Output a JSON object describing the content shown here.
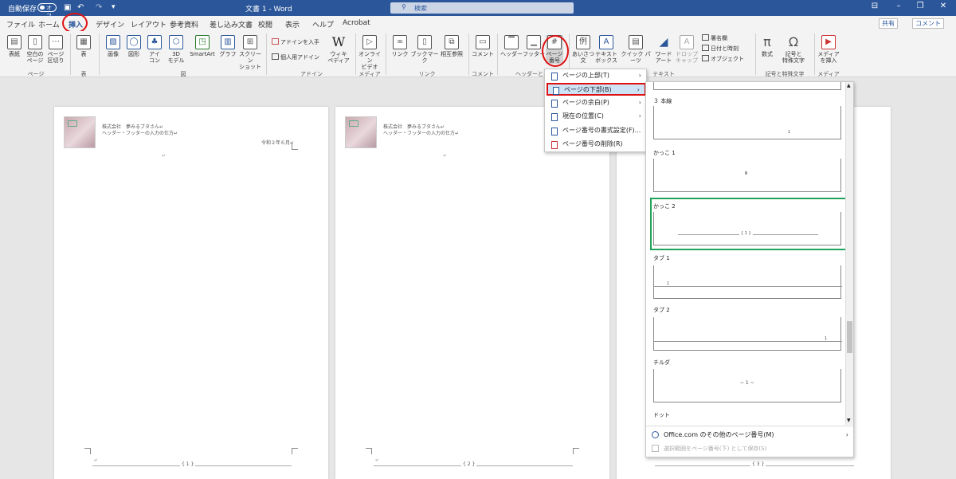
{
  "titlebar": {
    "autosave": "自動保存",
    "toggle": "オフ",
    "doc_title": "文書 1 - Word",
    "search": "検索",
    "qa_more": "▾"
  },
  "tabs": [
    "ファイル",
    "ホーム",
    "挿入",
    "デザイン",
    "レイアウト",
    "参考資料",
    "差し込み文書",
    "校閲",
    "表示",
    "ヘルプ",
    "Acrobat"
  ],
  "active_tab": "挿入",
  "top_right": {
    "share": "共有",
    "comment": "コメント"
  },
  "ribbon": {
    "pages": {
      "group": "ページ",
      "cover": "表紙",
      "blank": "空白の\nページ",
      "break": "ページ\n区切り"
    },
    "table": {
      "group": "表",
      "table": "表"
    },
    "illust": {
      "group": "図",
      "picture": "画像",
      "shapes": "図形",
      "icons": "アイ\nコン",
      "model3d": "3D\nモデル",
      "smartart": "SmartArt",
      "chart": "グラフ",
      "screenshot": "スクリーン\nショット"
    },
    "addins": {
      "group": "アドイン",
      "get": "アドインを入手",
      "my": "個人用アドイン",
      "wiki": "ウィキ\nペディア"
    },
    "media": {
      "group": "メディア",
      "video": "オンライン\nビデオ"
    },
    "links": {
      "group": "リンク",
      "link": "リンク",
      "bookmark": "ブックマーク",
      "cross": "相互参照"
    },
    "comment": {
      "group": "コメント",
      "comment": "コメント"
    },
    "hf": {
      "group": "ヘッダーとフ",
      "header": "ヘッダー",
      "footer": "フッター",
      "pagenum": "ページ\n番号"
    },
    "text": {
      "group": "テキスト",
      "greeting": "あいさつ\n文",
      "textbox": "テキスト\nボックス",
      "quick": "クイック パーツ",
      "wordart": "ワード\nアート",
      "dropcap": "ドロップ\nキャップ",
      "sig": "署名欄",
      "date": "日付と時刻",
      "obj": "オブジェクト"
    },
    "symbols": {
      "group": "記号と特殊文字",
      "eq": "数式",
      "sym": "記号と\n特殊文字"
    },
    "media2": {
      "group": "メディア",
      "insert": "メディア\nを挿入"
    }
  },
  "doc": {
    "hdr1": "株式会社　夢みるブタさん↵",
    "hdr2": "ヘッダー・フッターの入力の仕方↵",
    "date": "令和２年６月↵",
    "foot": [
      "{ 1 }",
      "{ 2 }",
      "{ 3 }"
    ]
  },
  "page_menu": [
    {
      "label": "ページの上部(T)",
      "arrow": "›",
      "hl": false
    },
    {
      "label": "ページの下部(B)",
      "arrow": "›",
      "hl": true
    },
    {
      "label": "ページの余白(P)",
      "arrow": "›",
      "hl": false
    },
    {
      "label": "現在の位置(C)",
      "arrow": "›",
      "hl": false
    },
    {
      "label": "ページ番号の書式設定(F)...",
      "arrow": "",
      "hl": false
    },
    {
      "label": "ページ番号の削除(R)",
      "arrow": "",
      "hl": false
    }
  ],
  "gallery": {
    "items": [
      "３ 本線",
      "かっこ 1",
      "かっこ 2",
      "タブ 1",
      "タブ 2",
      "チルダ",
      "ドット"
    ],
    "previews": [
      "1",
      "Ⅲ",
      "{ 1 }",
      "1",
      "1",
      "~ 1 ~",
      ""
    ],
    "more": "Office.com のその他のページ番号(M)",
    "more_arrow": "›",
    "save": "選択範囲をページ番号(下) として保存(S)"
  },
  "colors": {
    "accent": "#2b579a",
    "highlight": "#d11111",
    "selection": "#22a35a"
  }
}
